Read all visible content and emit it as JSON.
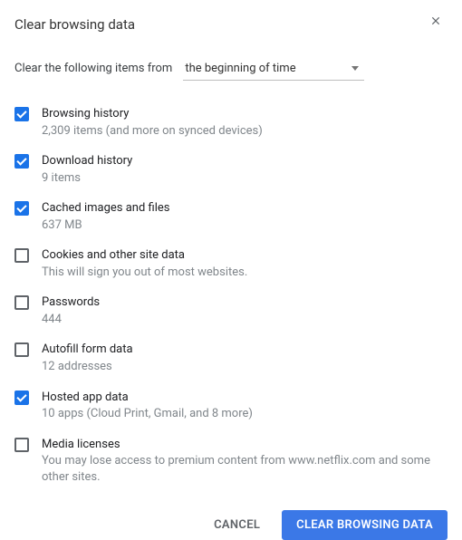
{
  "dialog": {
    "title": "Clear browsing data",
    "closeIcon": "close"
  },
  "range": {
    "label": "Clear the following items from",
    "selected": "the beginning of time"
  },
  "items": [
    {
      "title": "Browsing history",
      "sub": "2,309 items (and more on synced devices)",
      "checked": true
    },
    {
      "title": "Download history",
      "sub": "9 items",
      "checked": true
    },
    {
      "title": "Cached images and files",
      "sub": "637 MB",
      "checked": true
    },
    {
      "title": "Cookies and other site data",
      "sub": "This will sign you out of most websites.",
      "checked": false
    },
    {
      "title": "Passwords",
      "sub": "444",
      "checked": false
    },
    {
      "title": "Autofill form data",
      "sub": "12 addresses",
      "checked": false
    },
    {
      "title": "Hosted app data",
      "sub": "10 apps (Cloud Print, Gmail, and 8 more)",
      "checked": true
    },
    {
      "title": "Media licenses",
      "sub": "You may lose access to premium content from www.netflix.com and some other sites.",
      "checked": false
    }
  ],
  "footer": {
    "cancel": "CANCEL",
    "confirm": "CLEAR BROWSING DATA"
  }
}
